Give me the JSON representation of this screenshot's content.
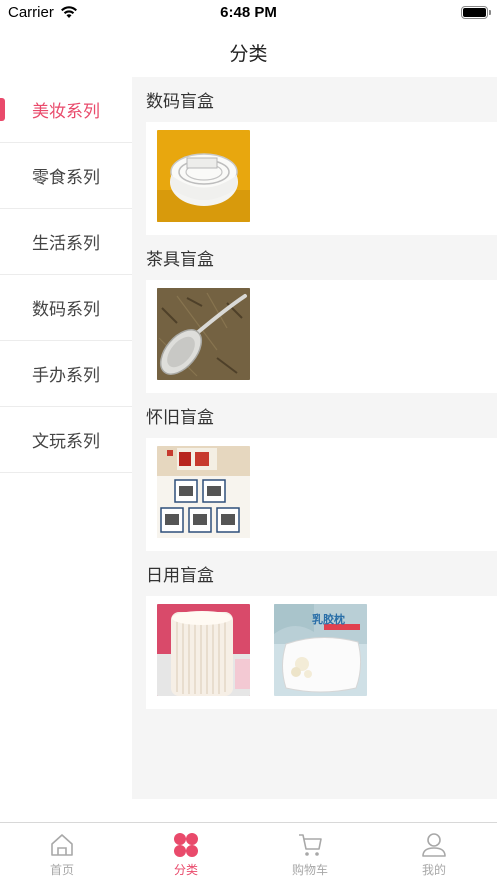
{
  "status_bar": {
    "carrier": "Carrier",
    "time": "6:48 PM"
  },
  "nav": {
    "title": "分类"
  },
  "sidebar": {
    "items": [
      {
        "label": "美妆系列",
        "active": true
      },
      {
        "label": "零食系列",
        "active": false
      },
      {
        "label": "生活系列",
        "active": false
      },
      {
        "label": "数码系列",
        "active": false
      },
      {
        "label": "手办系列",
        "active": false
      },
      {
        "label": "文玩系列",
        "active": false
      }
    ]
  },
  "sections": [
    {
      "title": "数码盲盒",
      "products": [
        {
          "image": "cable-coil"
        }
      ]
    },
    {
      "title": "茶具盲盒",
      "products": [
        {
          "image": "tea-spoon"
        }
      ]
    },
    {
      "title": "怀旧盲盒",
      "products": [
        {
          "image": "enamel-mugs"
        }
      ]
    },
    {
      "title": "日用盲盒",
      "products": [
        {
          "image": "cotton-swabs"
        },
        {
          "image": "latex-pillow",
          "caption": "乳胶枕"
        }
      ]
    }
  ],
  "tab_bar": {
    "tabs": [
      {
        "label": "首页",
        "icon": "home-icon"
      },
      {
        "label": "分类",
        "icon": "category-icon",
        "active": true
      },
      {
        "label": "购物车",
        "icon": "cart-icon"
      },
      {
        "label": "我的",
        "icon": "profile-icon"
      }
    ]
  },
  "colors": {
    "accent": "#e94a6b",
    "inactive": "#a8a8a8",
    "background": "#f5f5f5"
  }
}
